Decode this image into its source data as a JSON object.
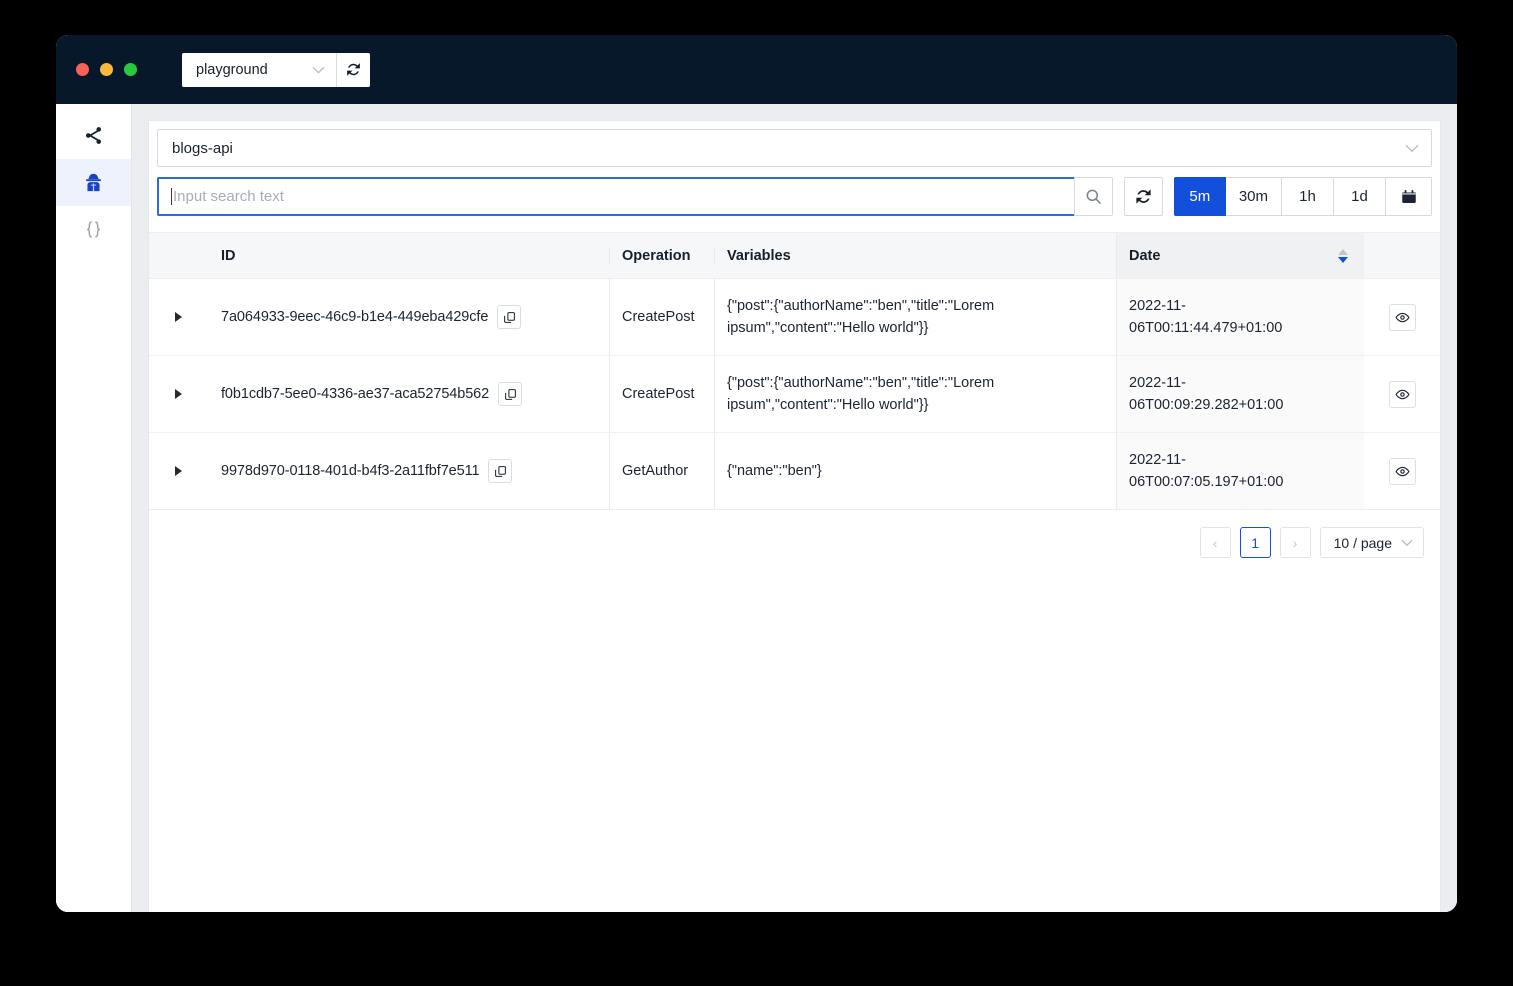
{
  "window": {
    "traffic_lights": [
      "close",
      "minimize",
      "maximize"
    ],
    "env_select": {
      "value": "playground",
      "icon": "chevron-down-icon"
    },
    "env_refresh_icon": "refresh-icon"
  },
  "sidebar": {
    "items": [
      {
        "name": "graph",
        "icon": "share-graph-icon",
        "active": false
      },
      {
        "name": "inspector",
        "icon": "detective-icon",
        "active": true
      },
      {
        "name": "schema",
        "icon": "braces-icon",
        "active": false
      }
    ]
  },
  "toolbar": {
    "api_select": {
      "value": "blogs-api",
      "icon": "chevron-down-icon"
    },
    "search": {
      "value": "",
      "placeholder": "Input search text"
    },
    "search_icon": "search-icon",
    "refresh_icon": "refresh-icon",
    "ranges": [
      {
        "label": "5m",
        "active": true
      },
      {
        "label": "30m",
        "active": false
      },
      {
        "label": "1h",
        "active": false
      },
      {
        "label": "1d",
        "active": false
      }
    ],
    "calendar_icon": "calendar-icon"
  },
  "table": {
    "columns": [
      "ID",
      "Operation",
      "Variables",
      "Date"
    ],
    "sort": {
      "column": "Date",
      "direction": "desc"
    },
    "rows": [
      {
        "id": "7a064933-9eec-46c9-b1e4-449eba429cfe",
        "operation": "CreatePost",
        "variables": "{\"post\":{\"authorName\":\"ben\",\"title\":\"Lorem ipsum\",\"content\":\"Hello world\"}}",
        "date": "2022-11-06T00:11:44.479+01:00"
      },
      {
        "id": "f0b1cdb7-5ee0-4336-ae37-aca52754b562",
        "operation": "CreatePost",
        "variables": "{\"post\":{\"authorName\":\"ben\",\"title\":\"Lorem ipsum\",\"content\":\"Hello world\"}}",
        "date": "2022-11-06T00:09:29.282+01:00"
      },
      {
        "id": "9978d970-0118-401d-b4f3-2a11fbf7e511",
        "operation": "GetAuthor",
        "variables": "{\"name\":\"ben\"}",
        "date": "2022-11-06T00:07:05.197+01:00"
      }
    ],
    "row_copy_icon": "copy-icon",
    "row_view_icon": "eye-icon",
    "row_expand_icon": "caret-right-icon"
  },
  "pagination": {
    "prev": "‹",
    "pages": [
      "1"
    ],
    "current_page": "1",
    "next": "›",
    "page_size": "10 / page",
    "page_size_icon": "chevron-down-icon"
  },
  "colors": {
    "accent": "#1250dc",
    "titlebar": "#07182a",
    "page_bg": "#ebedf0",
    "focus_border": "#2f6bd8"
  }
}
